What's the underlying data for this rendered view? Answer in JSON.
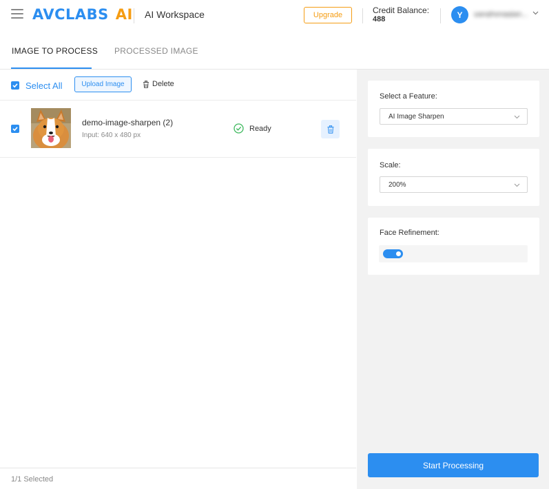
{
  "header": {
    "logo_brand": "AVCLABS",
    "logo_ai": "AI",
    "workspace_title": "AI Workspace",
    "upgrade_label": "Upgrade",
    "credit_label": "Credit Balance:",
    "credit_value": "488",
    "avatar_initial": "Y",
    "username": "yanghongqian..."
  },
  "tabs": [
    {
      "label": "IMAGE TO PROCESS",
      "active": true
    },
    {
      "label": "PROCESSED IMAGE",
      "active": false
    }
  ],
  "toolbar": {
    "select_all_label": "Select All",
    "upload_label": "Upload Image",
    "delete_label": "Delete"
  },
  "files": [
    {
      "name": "demo-image-sharpen (2)",
      "input_size": "Input: 640 x 480 px",
      "status": "Ready",
      "checked": true
    }
  ],
  "footer": {
    "selected_text": "1/1 Selected"
  },
  "settings": {
    "feature_label": "Select a Feature:",
    "feature_value": "AI Image Sharpen",
    "scale_label": "Scale:",
    "scale_value": "200%",
    "face_label": "Face Refinement:",
    "face_enabled": true
  },
  "actions": {
    "start_label": "Start Processing"
  },
  "colors": {
    "accent": "#2c8ef0",
    "brand_orange": "#f59c12",
    "ready_green": "#3cb85c"
  }
}
